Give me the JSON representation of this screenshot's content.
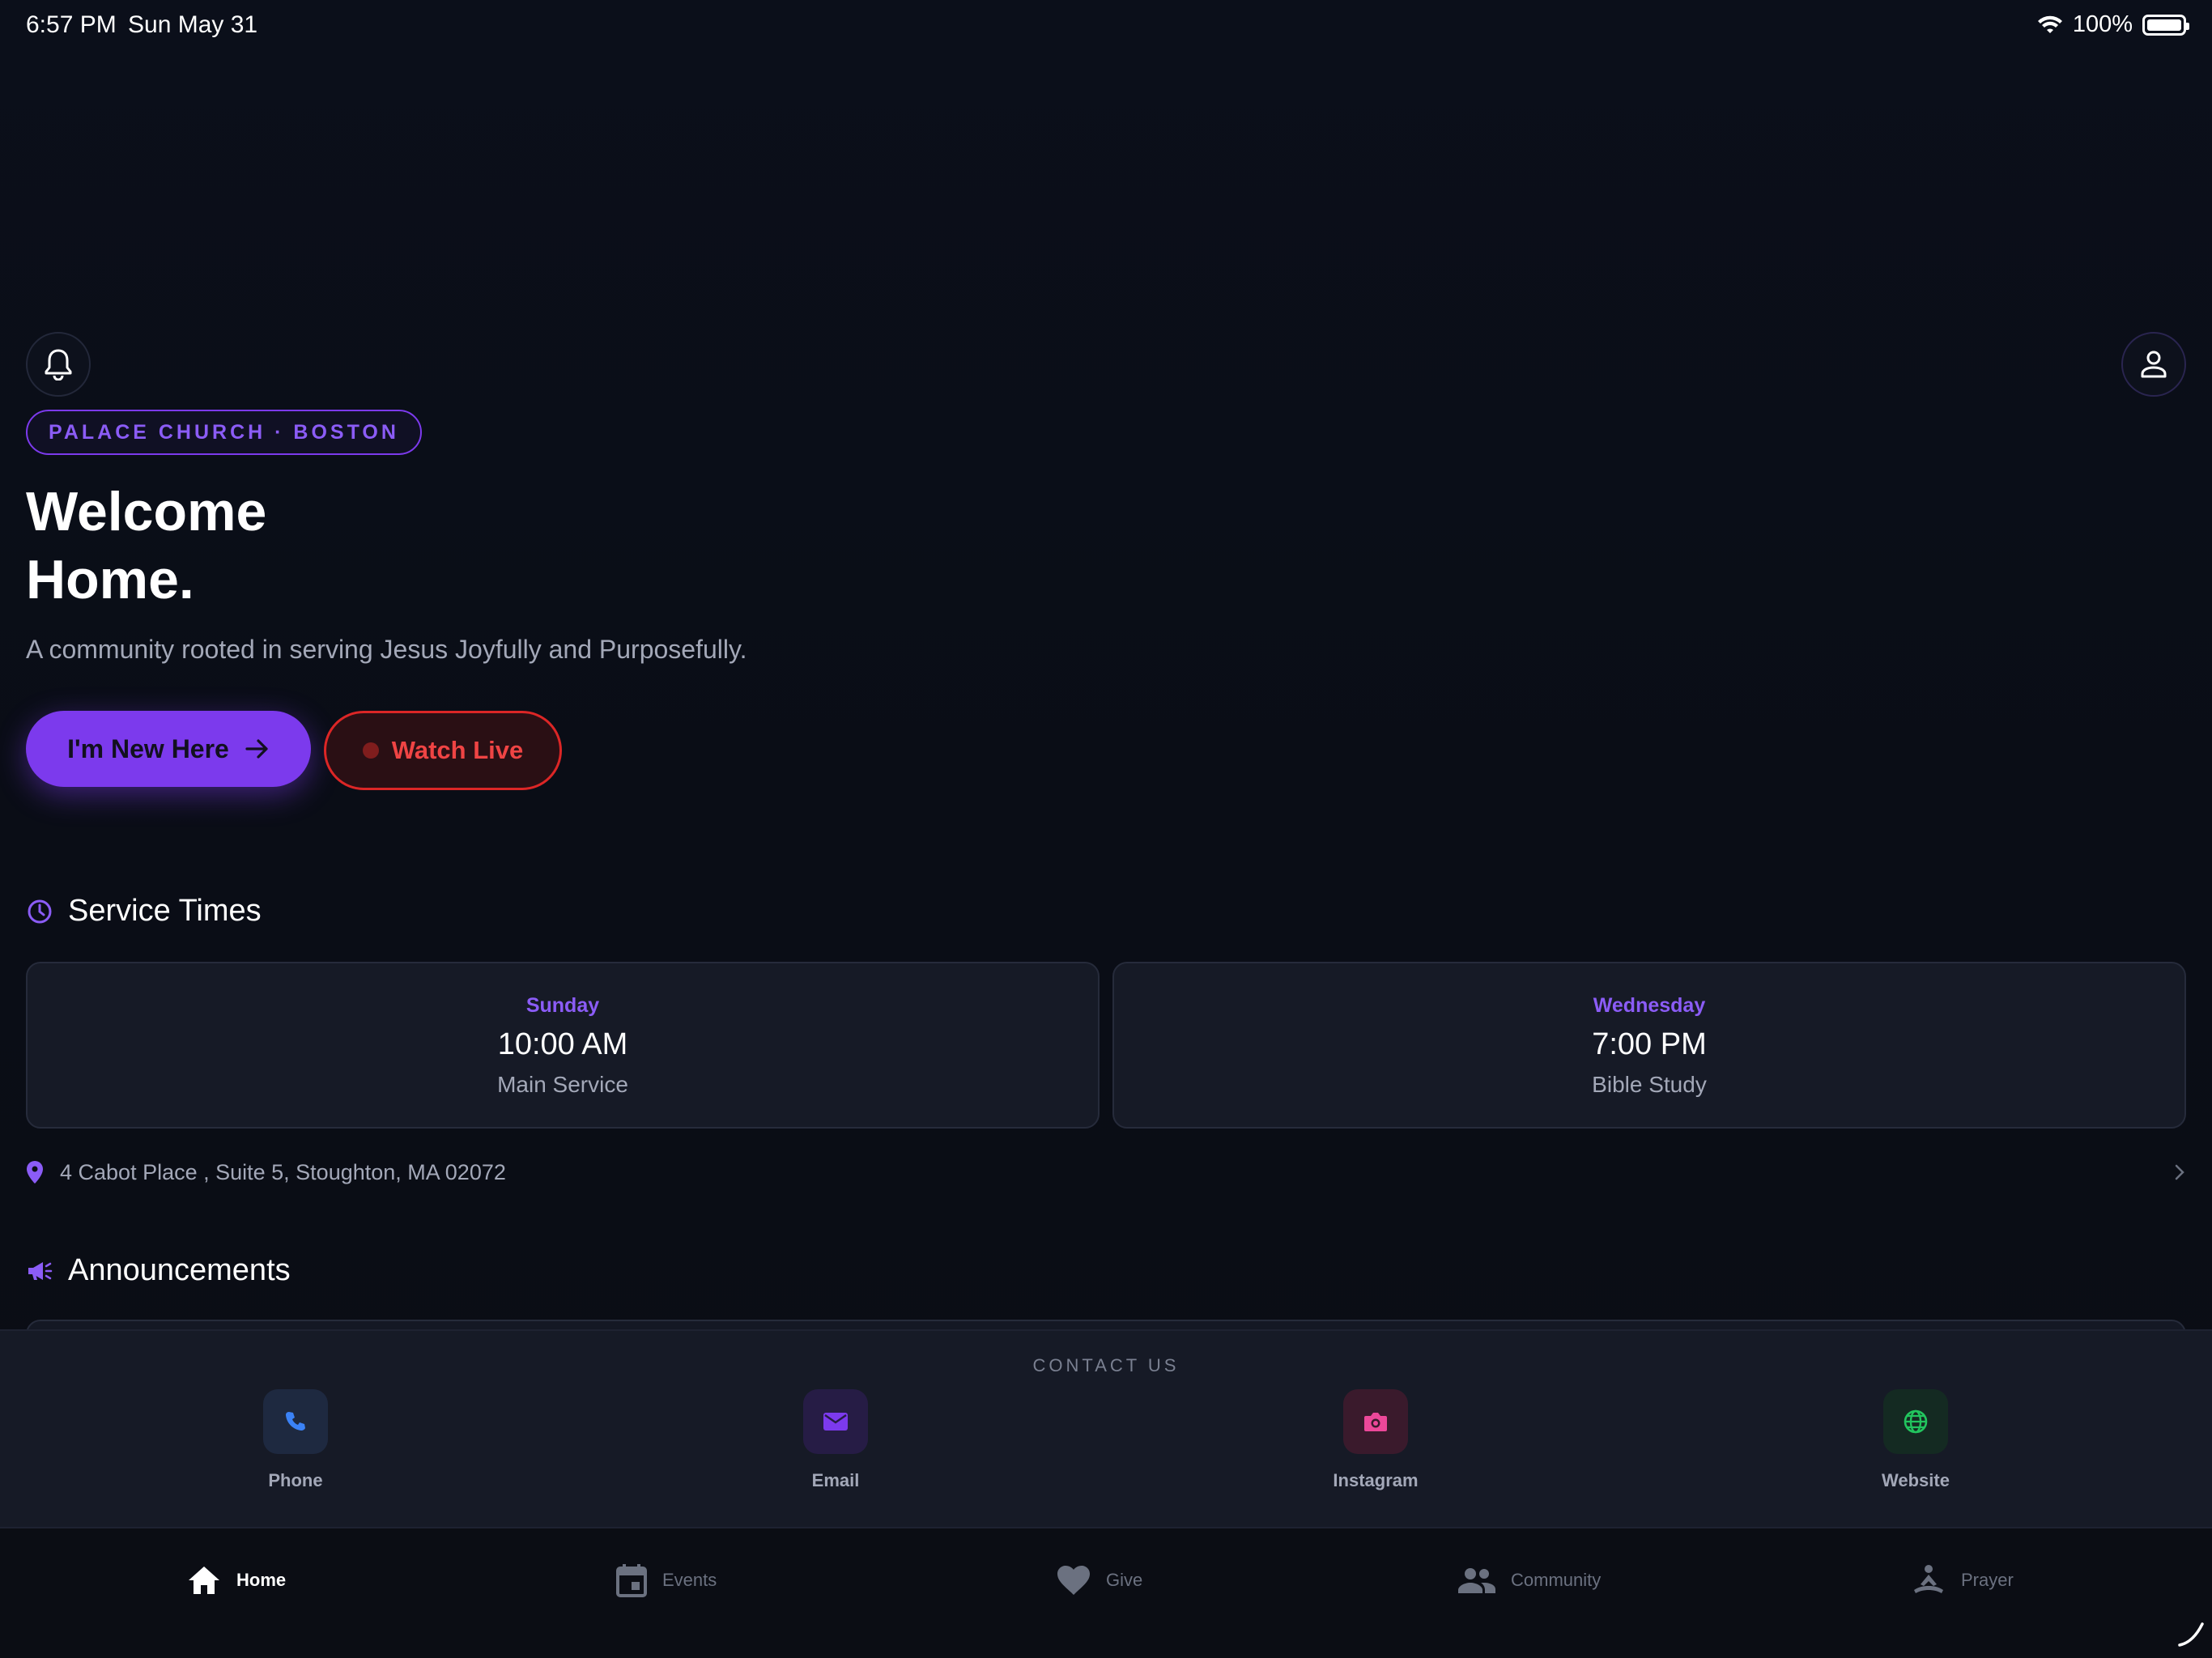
{
  "status_bar": {
    "time": "6:57 PM",
    "date": "Sun May 31",
    "battery": "100%"
  },
  "hero": {
    "badge": "PALACE CHURCH · BOSTON",
    "title_line1": "Welcome",
    "title_line2": "Home.",
    "subtitle": "A community rooted in serving Jesus Joyfully and Purposefully.",
    "new_here_label": "I'm New Here",
    "watch_live_label": "Watch Live"
  },
  "service_times": {
    "title": "Service Times",
    "services": [
      {
        "day": "Sunday",
        "time": "10:00 AM",
        "name": "Main Service"
      },
      {
        "day": "Wednesday",
        "time": "7:00 PM",
        "name": "Bible Study"
      }
    ],
    "address": "4 Cabot Place , Suite 5, Stoughton, MA 02072"
  },
  "announcements": {
    "title": "Announcements"
  },
  "contact": {
    "title": "CONTACT US",
    "items": [
      {
        "label": "Phone",
        "icon": "phone-icon",
        "color": "#3b82f6"
      },
      {
        "label": "Email",
        "icon": "mail-icon",
        "color": "#7c3aed"
      },
      {
        "label": "Instagram",
        "icon": "camera-icon",
        "color": "#ec4899"
      },
      {
        "label": "Website",
        "icon": "globe-icon",
        "color": "#22c55e"
      }
    ]
  },
  "nav": {
    "items": [
      {
        "label": "Home",
        "icon": "home-icon",
        "active": true
      },
      {
        "label": "Events",
        "icon": "calendar-icon",
        "active": false
      },
      {
        "label": "Give",
        "icon": "heart-icon",
        "active": false
      },
      {
        "label": "Community",
        "icon": "people-icon",
        "active": false
      },
      {
        "label": "Prayer",
        "icon": "prayer-icon",
        "active": false
      }
    ]
  },
  "colors": {
    "accent": "#7c3aed",
    "live": "#ef4444",
    "background": "#0b0e16",
    "card": "#161a26"
  }
}
